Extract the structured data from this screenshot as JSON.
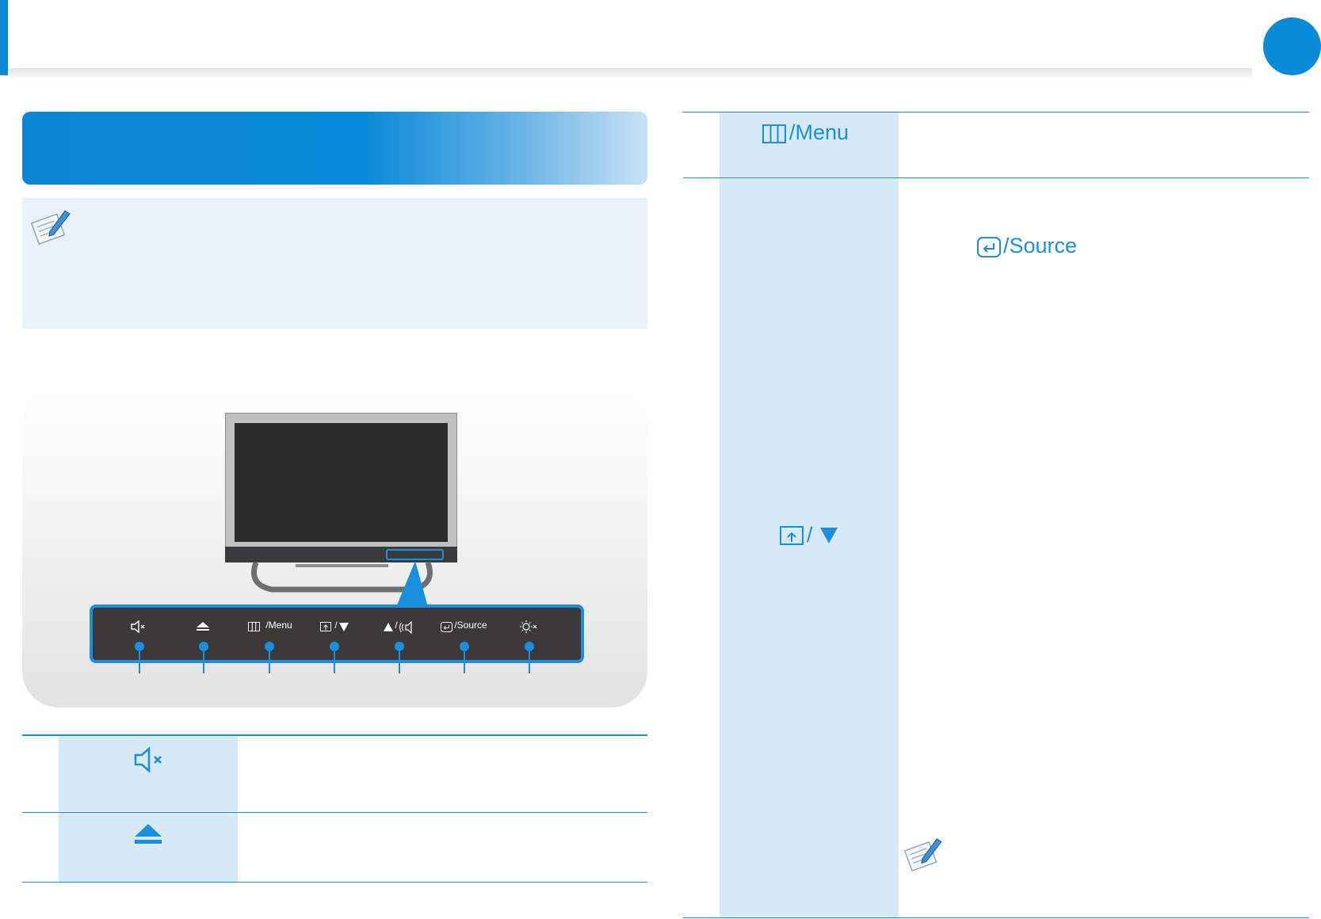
{
  "panel": {
    "labels": [
      "/Menu",
      "/",
      "/",
      "/Source"
    ],
    "item_count": 7
  },
  "right_table": {
    "menu_key": "/Menu",
    "source_key": "/Source",
    "slash": "/"
  },
  "icons": [
    "note-icon",
    "mute-icon",
    "eject-icon",
    "menu-icon",
    "input-icon",
    "down-arrow-icon",
    "up-arrow-icon",
    "volume-icon",
    "source-icon",
    "brightness-icon"
  ],
  "colors": {
    "accent": "#1a8fde",
    "shade": "#d7e8f6"
  }
}
